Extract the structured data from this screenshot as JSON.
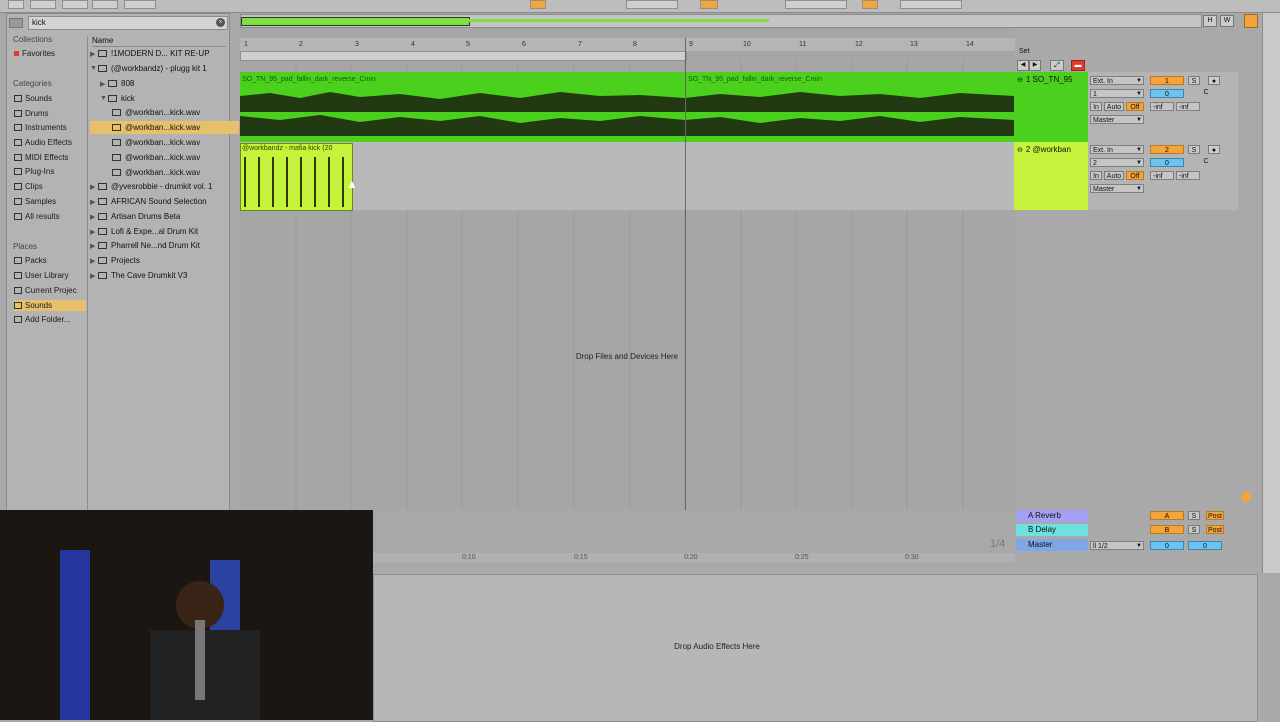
{
  "search": {
    "value": "kick"
  },
  "browser": {
    "collections_label": "Collections",
    "favorites": "Favorites",
    "categories_label": "Categories",
    "categories": [
      "Sounds",
      "Drums",
      "Instruments",
      "Audio Effects",
      "MIDI Effects",
      "Plug-Ins",
      "Clips",
      "Samples",
      "All results"
    ],
    "places_label": "Places",
    "places": [
      "Packs",
      "User Library",
      "Current Projec",
      "Sounds",
      "Add Folder..."
    ],
    "name_header": "Name",
    "files": [
      "!1MODERN D... KIT RE-UP",
      "(@workbandz) - plugg kit 1",
      "808",
      "kick",
      "@workban...kick.wav",
      "@workban...kick.wav",
      "@workban...kick.wav",
      "@workban...kick.wav",
      "@workban...kick.wav",
      "@yvesrobbie - drumkit vol. 1",
      "AFRICAN Sound Selection",
      "Artisan Drums Beta",
      "Lofi & Expe...al Drum Kit",
      "Pharrell Ne...nd Drum Kit",
      "Projects",
      "The Cave Drumkit V3"
    ]
  },
  "ruler": {
    "bars": [
      "1",
      "2",
      "3",
      "4",
      "5",
      "6",
      "7",
      "8",
      "9",
      "10",
      "11",
      "12",
      "13",
      "14"
    ],
    "set_label": "Set"
  },
  "tracks": [
    {
      "name": "1 SO_TN_95",
      "clip1": "SO_TN_95_pad_fallin_dark_reverse_Cmin",
      "clip2": "SO_TN_95_pad_fallin_dark_reverse_Cmin",
      "input": "Ext. In",
      "channel": "1",
      "output": "Master",
      "number": "1",
      "volume": "0",
      "pan": "C",
      "send_a": "-inf",
      "send_b": "-inf"
    },
    {
      "name": "2 @workban",
      "clip1": "@workbandz - mafia kick (20",
      "input": "Ext. In",
      "channel": "2",
      "output": "Master",
      "number": "2",
      "volume": "0",
      "pan": "C",
      "send_a": "-inf",
      "send_b": "-inf"
    }
  ],
  "monitor": {
    "in": "In",
    "auto": "Auto",
    "off": "Off"
  },
  "solo": "S",
  "returns": [
    {
      "name": "A Reverb",
      "letter": "A",
      "post": "Post",
      "color": "#a4a0f4"
    },
    {
      "name": "B Delay",
      "letter": "B",
      "post": "Post",
      "color": "#6fe0e2"
    },
    {
      "name": "Master",
      "letter": "",
      "post": "",
      "color": "#7fa6e8"
    }
  ],
  "master": {
    "cue": "ll 1/2",
    "volume": "0",
    "pan": "0"
  },
  "drop_files": "Drop Files and Devices Here",
  "drop_fx": "Drop Audio Effects Here",
  "time_marks": [
    "0:10",
    "0:15",
    "0:20",
    "0:25",
    "0:30"
  ],
  "fraction": "1/4",
  "colors": {
    "track1": "#4bd01e",
    "track2": "#c5f23a",
    "orange": "#f3a43a",
    "blue": "#6bc3f0"
  }
}
